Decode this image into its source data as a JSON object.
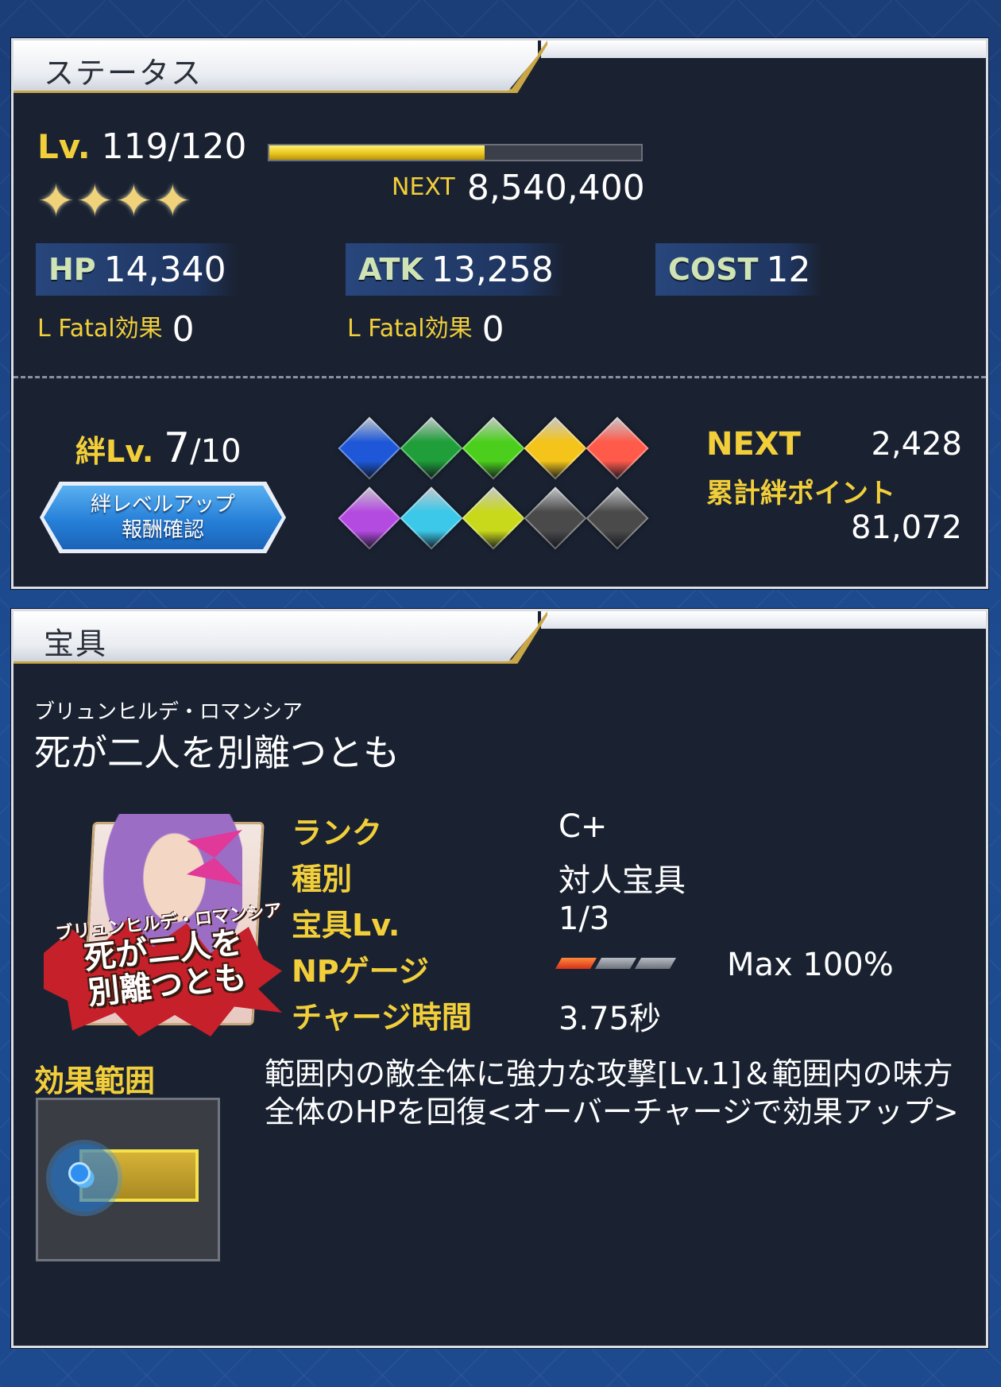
{
  "status": {
    "title": "ステータス",
    "level_label": "Lv.",
    "level_value": "119/120",
    "level_progress": 0.58,
    "next_label": "NEXT",
    "next_value": "8,540,400",
    "rarity_stars": 4,
    "hp_label": "HP",
    "hp_value": "14,340",
    "atk_label": "ATK",
    "atk_value": "13,258",
    "cost_label": "COST",
    "cost_value": "12",
    "fatal_label": "L Fatal効果",
    "hp_fatal": "0",
    "atk_fatal": "0"
  },
  "bond": {
    "label": "絆Lv.",
    "level": "7",
    "max": "/10",
    "button_line1": "絆レベルアップ",
    "button_line2": "報酬確認",
    "gems": [
      "#1e58d8",
      "#1f9e3a",
      "#4ccf1c",
      "#f4c41a",
      "#ff5a4a",
      "#b44be0",
      "#3cc8e8",
      "#c8d81a",
      "#4a4a4a",
      "#4a4a4a"
    ],
    "next_label": "NEXT",
    "next_value": "2,428",
    "total_label": "累計絆ポイント",
    "total_value": "81,072"
  },
  "np": {
    "title": "宝具",
    "ruby": "ブリュンヒルデ・ロマンシア",
    "name": "死が二人を別離つとも",
    "card_ruby": "ブリュンヒルデ・ロマンシア",
    "card_title_line1": "死が二人を",
    "card_title_line2": "別離つとも",
    "rank_label": "ランク",
    "rank_value": "C+",
    "type_label": "種別",
    "type_value": "対人宝具",
    "lv_label": "宝具Lv.",
    "lv_value": "1/3",
    "gauge_label": "NPゲージ",
    "gauge_value": "Max 100%",
    "gauge_filled": 1,
    "gauge_total": 3,
    "charge_label": "チャージ時間",
    "charge_value": "3.75秒",
    "area_label": "効果範囲",
    "description": "範囲内の敵全体に強力な攻撃[Lv.1]＆範囲内の味方全体のHPを回復<オーバーチャージで効果アップ>"
  }
}
